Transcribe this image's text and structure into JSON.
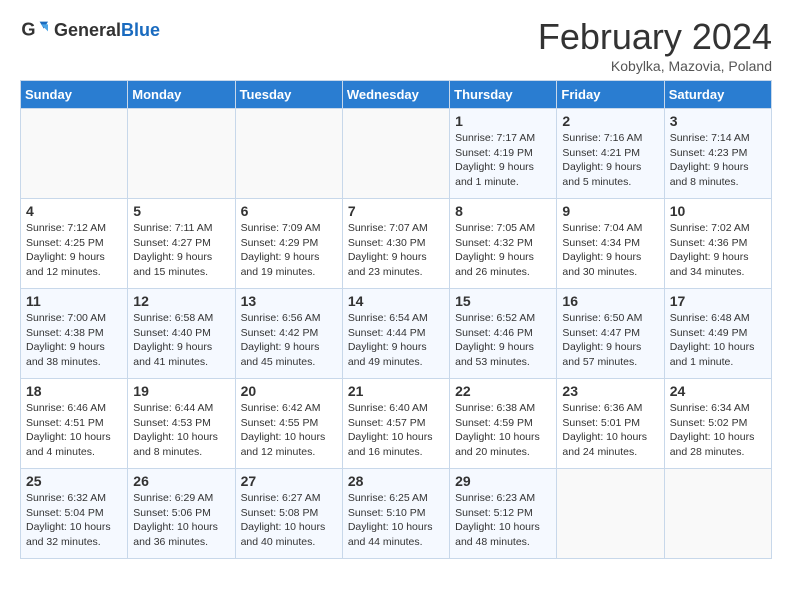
{
  "header": {
    "logo_general": "General",
    "logo_blue": "Blue",
    "title": "February 2024",
    "subtitle": "Kobylka, Mazovia, Poland"
  },
  "days_of_week": [
    "Sunday",
    "Monday",
    "Tuesday",
    "Wednesday",
    "Thursday",
    "Friday",
    "Saturday"
  ],
  "weeks": [
    [
      {
        "day": "",
        "info": ""
      },
      {
        "day": "",
        "info": ""
      },
      {
        "day": "",
        "info": ""
      },
      {
        "day": "",
        "info": ""
      },
      {
        "day": "1",
        "info": "Sunrise: 7:17 AM\nSunset: 4:19 PM\nDaylight: 9 hours and 1 minute."
      },
      {
        "day": "2",
        "info": "Sunrise: 7:16 AM\nSunset: 4:21 PM\nDaylight: 9 hours and 5 minutes."
      },
      {
        "day": "3",
        "info": "Sunrise: 7:14 AM\nSunset: 4:23 PM\nDaylight: 9 hours and 8 minutes."
      }
    ],
    [
      {
        "day": "4",
        "info": "Sunrise: 7:12 AM\nSunset: 4:25 PM\nDaylight: 9 hours and 12 minutes."
      },
      {
        "day": "5",
        "info": "Sunrise: 7:11 AM\nSunset: 4:27 PM\nDaylight: 9 hours and 15 minutes."
      },
      {
        "day": "6",
        "info": "Sunrise: 7:09 AM\nSunset: 4:29 PM\nDaylight: 9 hours and 19 minutes."
      },
      {
        "day": "7",
        "info": "Sunrise: 7:07 AM\nSunset: 4:30 PM\nDaylight: 9 hours and 23 minutes."
      },
      {
        "day": "8",
        "info": "Sunrise: 7:05 AM\nSunset: 4:32 PM\nDaylight: 9 hours and 26 minutes."
      },
      {
        "day": "9",
        "info": "Sunrise: 7:04 AM\nSunset: 4:34 PM\nDaylight: 9 hours and 30 minutes."
      },
      {
        "day": "10",
        "info": "Sunrise: 7:02 AM\nSunset: 4:36 PM\nDaylight: 9 hours and 34 minutes."
      }
    ],
    [
      {
        "day": "11",
        "info": "Sunrise: 7:00 AM\nSunset: 4:38 PM\nDaylight: 9 hours and 38 minutes."
      },
      {
        "day": "12",
        "info": "Sunrise: 6:58 AM\nSunset: 4:40 PM\nDaylight: 9 hours and 41 minutes."
      },
      {
        "day": "13",
        "info": "Sunrise: 6:56 AM\nSunset: 4:42 PM\nDaylight: 9 hours and 45 minutes."
      },
      {
        "day": "14",
        "info": "Sunrise: 6:54 AM\nSunset: 4:44 PM\nDaylight: 9 hours and 49 minutes."
      },
      {
        "day": "15",
        "info": "Sunrise: 6:52 AM\nSunset: 4:46 PM\nDaylight: 9 hours and 53 minutes."
      },
      {
        "day": "16",
        "info": "Sunrise: 6:50 AM\nSunset: 4:47 PM\nDaylight: 9 hours and 57 minutes."
      },
      {
        "day": "17",
        "info": "Sunrise: 6:48 AM\nSunset: 4:49 PM\nDaylight: 10 hours and 1 minute."
      }
    ],
    [
      {
        "day": "18",
        "info": "Sunrise: 6:46 AM\nSunset: 4:51 PM\nDaylight: 10 hours and 4 minutes."
      },
      {
        "day": "19",
        "info": "Sunrise: 6:44 AM\nSunset: 4:53 PM\nDaylight: 10 hours and 8 minutes."
      },
      {
        "day": "20",
        "info": "Sunrise: 6:42 AM\nSunset: 4:55 PM\nDaylight: 10 hours and 12 minutes."
      },
      {
        "day": "21",
        "info": "Sunrise: 6:40 AM\nSunset: 4:57 PM\nDaylight: 10 hours and 16 minutes."
      },
      {
        "day": "22",
        "info": "Sunrise: 6:38 AM\nSunset: 4:59 PM\nDaylight: 10 hours and 20 minutes."
      },
      {
        "day": "23",
        "info": "Sunrise: 6:36 AM\nSunset: 5:01 PM\nDaylight: 10 hours and 24 minutes."
      },
      {
        "day": "24",
        "info": "Sunrise: 6:34 AM\nSunset: 5:02 PM\nDaylight: 10 hours and 28 minutes."
      }
    ],
    [
      {
        "day": "25",
        "info": "Sunrise: 6:32 AM\nSunset: 5:04 PM\nDaylight: 10 hours and 32 minutes."
      },
      {
        "day": "26",
        "info": "Sunrise: 6:29 AM\nSunset: 5:06 PM\nDaylight: 10 hours and 36 minutes."
      },
      {
        "day": "27",
        "info": "Sunrise: 6:27 AM\nSunset: 5:08 PM\nDaylight: 10 hours and 40 minutes."
      },
      {
        "day": "28",
        "info": "Sunrise: 6:25 AM\nSunset: 5:10 PM\nDaylight: 10 hours and 44 minutes."
      },
      {
        "day": "29",
        "info": "Sunrise: 6:23 AM\nSunset: 5:12 PM\nDaylight: 10 hours and 48 minutes."
      },
      {
        "day": "",
        "info": ""
      },
      {
        "day": "",
        "info": ""
      }
    ]
  ]
}
